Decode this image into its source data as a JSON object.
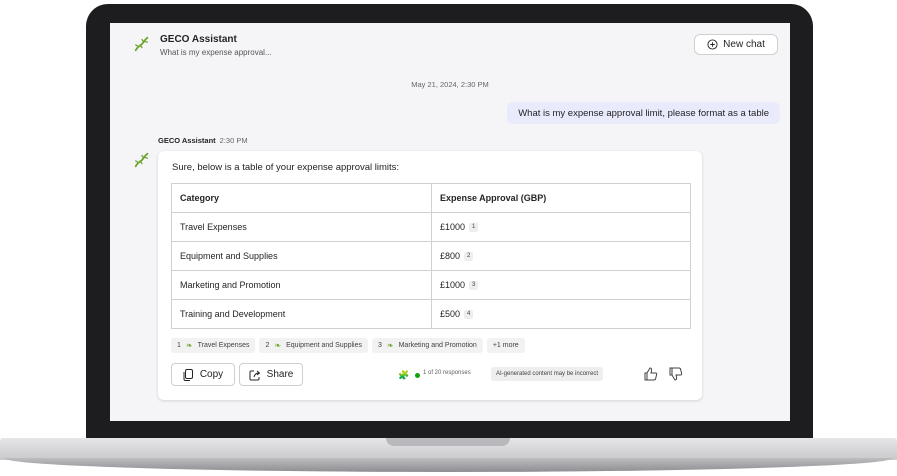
{
  "header": {
    "title": "GECO Assistant",
    "subtitle": "What is my expense approval...",
    "new_chat_label": "New chat"
  },
  "conversation": {
    "timestamp": "May 21, 2024, 2:30 PM",
    "user_message": "What is my expense approval limit, please format as a table",
    "bot_name": "GECO Assistant",
    "bot_time": "2:30 PM",
    "bot_intro": "Sure, below is a table of your expense approval limits:"
  },
  "table": {
    "headers": [
      "Category",
      "Expense Approval (GBP)"
    ],
    "rows": [
      {
        "category": "Travel Expenses",
        "amount": "£1000",
        "ref": "1"
      },
      {
        "category": "Equipment and Supplies",
        "amount": "£800",
        "ref": "2"
      },
      {
        "category": "Marketing and Promotion",
        "amount": "£1000",
        "ref": "3"
      },
      {
        "category": "Training and Development",
        "amount": "£500",
        "ref": "4"
      }
    ]
  },
  "citations": [
    {
      "num": "1",
      "label": "Travel Expenses"
    },
    {
      "num": "2",
      "label": "Equipment and Supplies"
    },
    {
      "num": "3",
      "label": "Marketing and Promotion"
    }
  ],
  "more_citations": "+1 more",
  "actions": {
    "copy_label": "Copy",
    "share_label": "Share",
    "responses": "1 of 20 responses",
    "ai_notice": "AI-generated content may be incorrect"
  },
  "icons": {
    "logo": "gecko-logo-icon",
    "new_chat": "plus-circle-icon",
    "copy": "copy-icon",
    "share": "share-icon",
    "thumbs_up": "thumbs-up-icon",
    "thumbs_down": "thumbs-down-icon"
  },
  "colors": {
    "user_bubble": "#e9ebfd",
    "status_dot": "#13a10e",
    "gecko": "#6aa52a"
  }
}
